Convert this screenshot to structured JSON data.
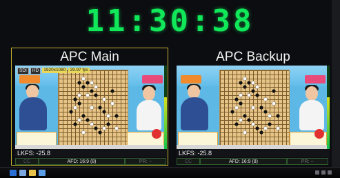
{
  "clock": {
    "time": "11:30:38"
  },
  "panels": {
    "main": {
      "title": "APC Main",
      "tags": [
        "SDI",
        "HD",
        "1920x1080",
        "29.97 fps"
      ],
      "lkfs": "LKFS: -25.8",
      "status": {
        "cc": "CC",
        "afd": "AFD: 16:9 (8)",
        "pr": "PR: --"
      },
      "meter_level": 0.62
    },
    "backup": {
      "title": "APC Backup",
      "lkfs": "LKFS: -25.8",
      "status": {
        "cc": "CC",
        "afd": "AFD: 16:9 (8)",
        "pr": "PR: --"
      },
      "meter_level": 0.62
    }
  },
  "colors": {
    "clock": "#10e85a",
    "main_border": "#c8b531",
    "tag_bg": "#e8d85a"
  },
  "icons": [
    "start-icon",
    "app-icon-1",
    "app-icon-2",
    "app-icon-3"
  ]
}
